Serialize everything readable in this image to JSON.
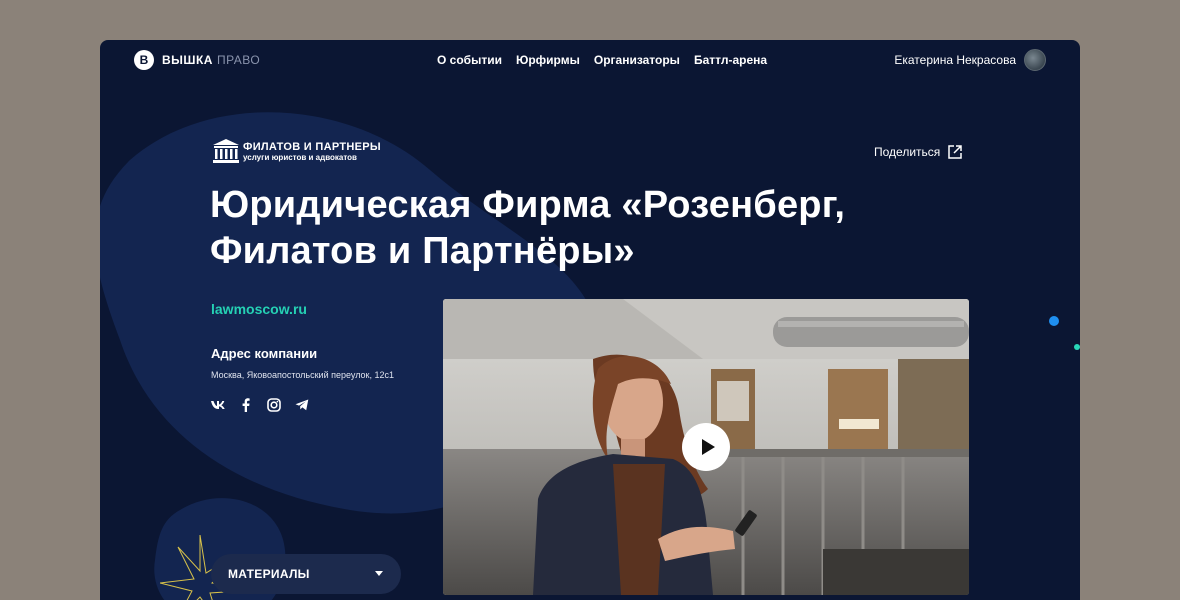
{
  "header": {
    "logo_mark": "В",
    "logo_text": "ВЫШКА",
    "logo_sub": "ПРАВО",
    "nav": [
      "О событии",
      "Юрфирмы",
      "Организаторы",
      "Баттл-арена"
    ],
    "user_name": "Екатерина Некрасова"
  },
  "firm": {
    "logo_name": "ФИЛАТОВ И ПАРТНЕРЫ",
    "logo_tagline": "услуги юристов и адвокатов",
    "title_line1": "Юридическая Фирма «Розенберг,",
    "title_line2": "Филатов и Партнёры»",
    "site": "lawmoscow.ru",
    "address_heading": "Адрес компании",
    "address": "Москва, Яковоапостольский переулок, 12с1"
  },
  "share_label": "Поделиться",
  "materials_label": "МАТЕРИАЛЫ",
  "socials": [
    "vk-icon",
    "facebook-icon",
    "instagram-icon",
    "telegram-icon"
  ],
  "colors": {
    "background": "#0b1633",
    "accent_green": "#25d1b4",
    "accent_blue": "#1f8ff0",
    "frame": "#8b8279"
  }
}
